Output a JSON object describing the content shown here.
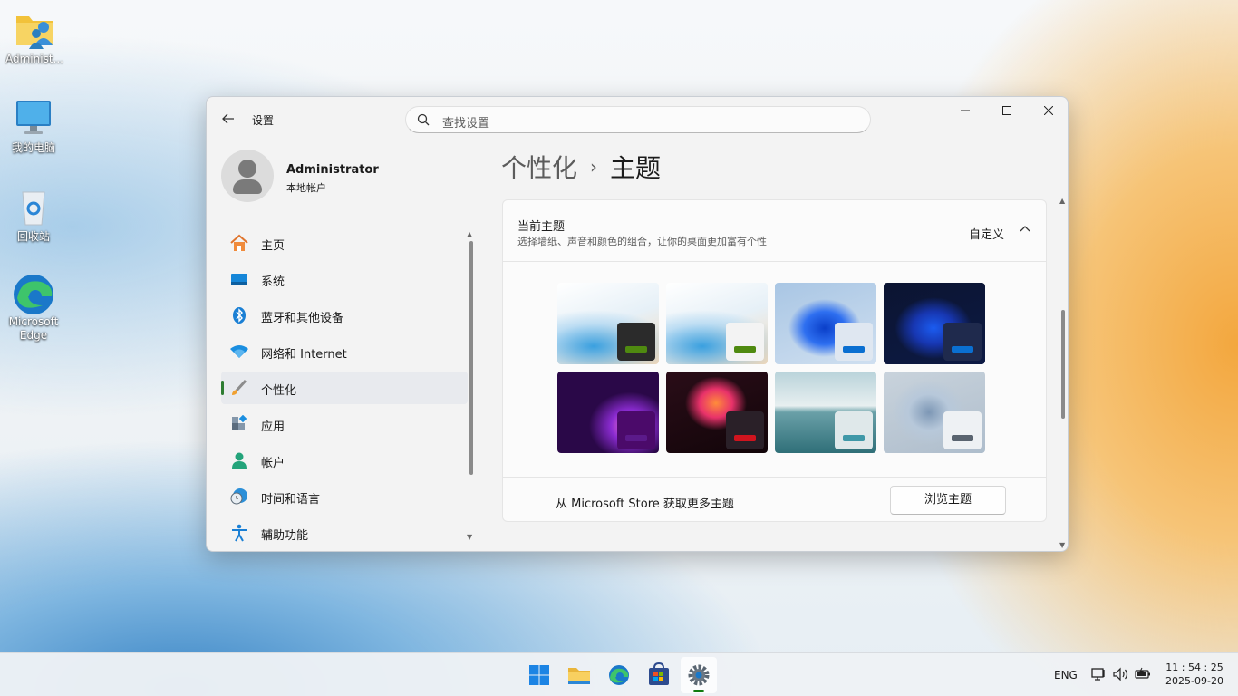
{
  "desktop": {
    "icons": [
      {
        "label": "Administ...",
        "icon": "user-folder-icon"
      },
      {
        "label": "我的电脑",
        "icon": "monitor-icon"
      },
      {
        "label": "回收站",
        "icon": "recycle-bin-icon"
      },
      {
        "label": "Microsoft Edge",
        "icon": "edge-icon"
      }
    ]
  },
  "window": {
    "app_title": "设置",
    "search_placeholder": "查找设置",
    "controls": {
      "minimize": "—",
      "maximize": "☐",
      "close": "✕"
    }
  },
  "profile": {
    "name": "Administrator",
    "type": "本地帐户"
  },
  "sidebar": {
    "items": [
      {
        "label": "主页",
        "icon": "home-icon",
        "active": false
      },
      {
        "label": "系统",
        "icon": "system-icon",
        "active": false
      },
      {
        "label": "蓝牙和其他设备",
        "icon": "bluetooth-icon",
        "active": false
      },
      {
        "label": "网络和 Internet",
        "icon": "wifi-icon",
        "active": false
      },
      {
        "label": "个性化",
        "icon": "brush-icon",
        "active": true
      },
      {
        "label": "应用",
        "icon": "apps-icon",
        "active": false
      },
      {
        "label": "帐户",
        "icon": "account-icon",
        "active": false
      },
      {
        "label": "时间和语言",
        "icon": "time-language-icon",
        "active": false
      },
      {
        "label": "辅助功能",
        "icon": "accessibility-icon",
        "active": false
      }
    ]
  },
  "breadcrumb": {
    "parent": "个性化",
    "separator": "›",
    "current": "主题"
  },
  "current_theme": {
    "title": "当前主题",
    "subtitle": "选择墙纸、声音和颜色的组合，让你的桌面更加富有个性",
    "value": "自定义",
    "themes": [
      {
        "name": "theme-1",
        "bg": "light-bloom-custom",
        "swatch_bg": "#2b2b2b",
        "bar": "#4f8a10"
      },
      {
        "name": "theme-2",
        "bg": "light-bloom",
        "swatch_bg": "#f3f3f3",
        "bar": "#4f8a10"
      },
      {
        "name": "theme-3",
        "bg": "windows-light",
        "swatch_bg": "#dfe7f1",
        "bar": "#0a6fd1"
      },
      {
        "name": "theme-4",
        "bg": "windows-dark",
        "swatch_bg": "#1f2a4d",
        "bar": "#0a6fd1"
      },
      {
        "name": "theme-5",
        "bg": "glow",
        "swatch_bg": "#4b0a6a",
        "bar": "#5b1a8a"
      },
      {
        "name": "theme-6",
        "bg": "captured-motion",
        "swatch_bg": "#2a2028",
        "bar": "#d0141e"
      },
      {
        "name": "theme-7",
        "bg": "sunrise",
        "swatch_bg": "#dfe8ea",
        "bar": "#3f98a8"
      },
      {
        "name": "theme-8",
        "bg": "flow",
        "swatch_bg": "#eef1f4",
        "bar": "#5a6470"
      }
    ],
    "store_text": "从 Microsoft Store 获取更多主题",
    "browse_button": "浏览主题"
  },
  "taskbar": {
    "apps": [
      "start-icon",
      "file-explorer-icon",
      "edge-icon",
      "store-icon",
      "settings-icon"
    ],
    "language": "ENG",
    "time": "11 : 54 : 25",
    "date": "2025-09-20"
  }
}
